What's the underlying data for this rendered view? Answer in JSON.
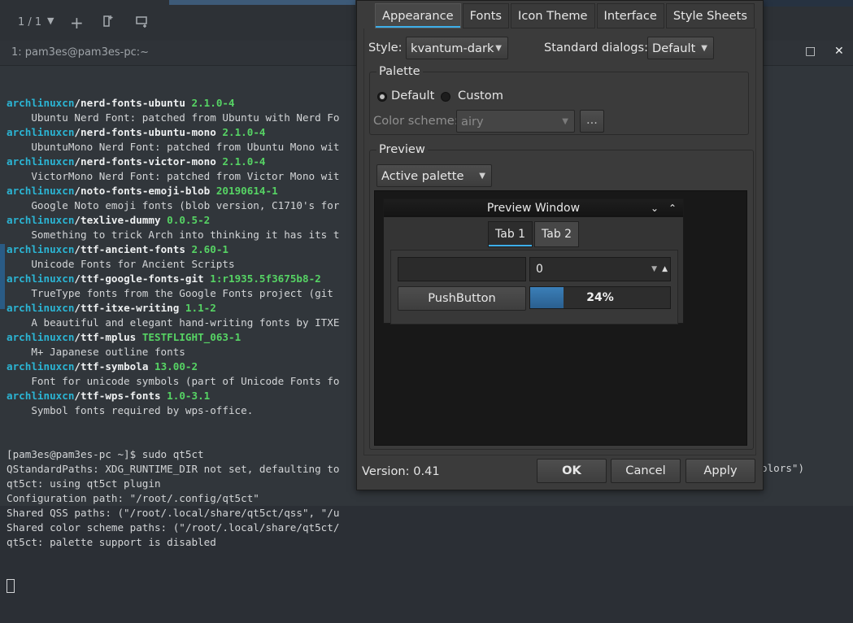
{
  "terminal": {
    "tab_counter": "1 / 1",
    "tab_title": "1: pam3es@pam3es-pc:~",
    "toolbar_icons": [
      "chevron-down-icon",
      "plus-icon",
      "new-window-icon",
      "split-view-icon"
    ],
    "window_controls": {
      "restore": "□",
      "close": "✕"
    },
    "packages": [
      {
        "repo": "archlinuxcn",
        "name": "nerd-fonts-ubuntu",
        "version": "2.1.0-4",
        "desc": "    Ubuntu Nerd Font: patched from Ubuntu with Nerd Fo"
      },
      {
        "repo": "archlinuxcn",
        "name": "nerd-fonts-ubuntu-mono",
        "version": "2.1.0-4",
        "desc": "    UbuntuMono Nerd Font: patched from Ubuntu Mono wit"
      },
      {
        "repo": "archlinuxcn",
        "name": "nerd-fonts-victor-mono",
        "version": "2.1.0-4",
        "desc": "    VictorMono Nerd Font: patched from Victor Mono wit"
      },
      {
        "repo": "archlinuxcn",
        "name": "noto-fonts-emoji-blob",
        "version": "20190614-1",
        "desc": "    Google Noto emoji fonts (blob version, C1710's for"
      },
      {
        "repo": "archlinuxcn",
        "name": "texlive-dummy",
        "version": "0.0.5-2",
        "desc": "    Something to trick Arch into thinking it has its t"
      },
      {
        "repo": "archlinuxcn",
        "name": "ttf-ancient-fonts",
        "version": "2.60-1",
        "desc": "    Unicode Fonts for Ancient Scripts"
      },
      {
        "repo": "archlinuxcn",
        "name": "ttf-google-fonts-git",
        "version": "1:r1935.5f3675b8-2",
        "desc": "    TrueType fonts from the Google Fonts project (git"
      },
      {
        "repo": "archlinuxcn",
        "name": "ttf-itxe-writing",
        "version": "1.1-2",
        "desc": "    A beautiful and elegant hand-writing fonts by ITXE"
      },
      {
        "repo": "archlinuxcn",
        "name": "ttf-mplus",
        "version": "TESTFLIGHT_063-1",
        "desc": "    M+ Japanese outline fonts"
      },
      {
        "repo": "archlinuxcn",
        "name": "ttf-symbola",
        "version": "13.00-2",
        "desc": "    Font for unicode symbols (part of Unicode Fonts fo"
      },
      {
        "repo": "archlinuxcn",
        "name": "ttf-wps-fonts",
        "version": "1.0-3.1",
        "desc": "    Symbol fonts required by wps-office."
      }
    ],
    "output_lines": [
      "[pam3es@pam3es-pc ~]$ sudo qt5ct",
      "QStandardPaths: XDG_RUNTIME_DIR not set, defaulting to",
      "qt5ct: using qt5ct plugin",
      "Configuration path: \"/root/.config/qt5ct\"",
      "Shared QSS paths: (\"/root/.local/share/qt5ct/qss\", \"/u",
      "Shared color scheme paths: (\"/root/.local/share/qt5ct/",
      "qt5ct: palette support is disabled"
    ],
    "behind_dialog_fragment": "olors\")"
  },
  "dialog": {
    "tabs": [
      {
        "label": "Appearance",
        "active": true
      },
      {
        "label": "Fonts",
        "active": false
      },
      {
        "label": "Icon Theme",
        "active": false
      },
      {
        "label": "Interface",
        "active": false
      },
      {
        "label": "Style Sheets",
        "active": false
      }
    ],
    "style_label": "Style:",
    "style_value": "kvantum-dark",
    "std_dialogs_label": "Standard dialogs:",
    "std_dialogs_value": "Default",
    "palette": {
      "title": "Palette",
      "default_label": "Default",
      "custom_label": "Custom",
      "selected": "Default",
      "color_scheme_label": "Color scheme:",
      "color_scheme_value": "airy",
      "browse_label": "..."
    },
    "preview": {
      "title": "Preview",
      "palette_select": "Active palette",
      "window_title": "Preview Window",
      "tabs": [
        {
          "label": "Tab 1",
          "active": true
        },
        {
          "label": "Tab 2",
          "active": false
        }
      ],
      "line_edit_value": "",
      "spin_value": "0",
      "push_button": "PushButton",
      "progress_percent": 24,
      "progress_text": "24%"
    },
    "version": "Version: 0.41",
    "buttons": {
      "ok": "OK",
      "cancel": "Cancel",
      "apply": "Apply"
    },
    "accent_color": "#3daee9"
  }
}
